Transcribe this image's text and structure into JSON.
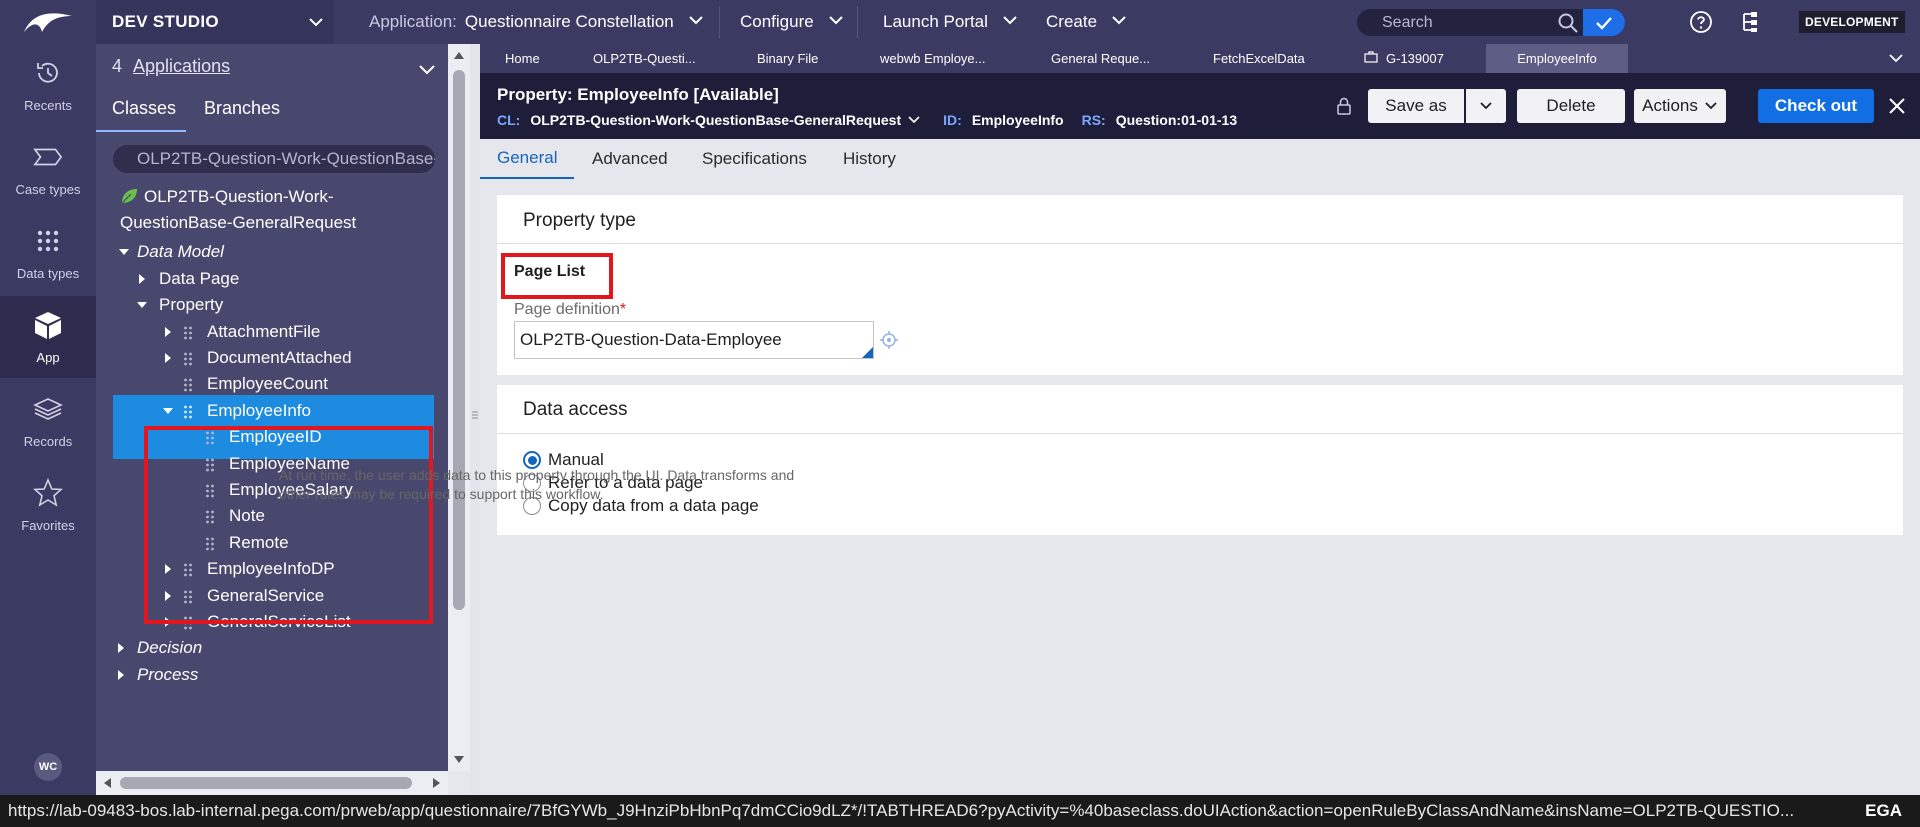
{
  "topbar": {
    "studio": "DEV STUDIO",
    "application_label": "Application:",
    "application_name": "Questionnaire Constellation",
    "configure": "Configure",
    "launch_portal": "Launch Portal",
    "create": "Create",
    "search_placeholder": "Search",
    "environment": "DEVELOPMENT"
  },
  "rail": {
    "items": [
      {
        "label": "Recents",
        "icon": "history-icon"
      },
      {
        "label": "Case types",
        "icon": "case-types-icon"
      },
      {
        "label": "Data types",
        "icon": "data-types-icon"
      },
      {
        "label": "App",
        "icon": "app-cube-icon"
      },
      {
        "label": "Records",
        "icon": "records-icon"
      },
      {
        "label": "Favorites",
        "icon": "star-icon"
      }
    ],
    "user_initials": "WC"
  },
  "explorer": {
    "apps_count": "4",
    "apps_label": "Applications",
    "tabs": [
      "Classes",
      "Branches"
    ],
    "class_filter": "OLP2TB-Question-Work-QuestionBase-GeneralRequest",
    "root_class_line1": "OLP2TB-Question-Work-",
    "root_class_line2": "QuestionBase-GeneralRequest",
    "tree": {
      "data_model": "Data Model",
      "data_page": "Data Page",
      "property": "Property",
      "attachment_file": "AttachmentFile",
      "document_attached": "DocumentAttached",
      "employee_count": "EmployeeCount",
      "employee_info": "EmployeeInfo",
      "employee_id": "EmployeeID",
      "employee_name": "EmployeeName",
      "employee_salary": "EmployeeSalary",
      "note": "Note",
      "remote": "Remote",
      "employee_info_dp": "EmployeeInfoDP",
      "general_service": "GeneralService",
      "general_service_list": "GeneralServiceList",
      "decision": "Decision",
      "process": "Process"
    }
  },
  "work_tabs": [
    "Home",
    "OLP2TB-Questi...",
    "Binary File",
    "webwb Employe...",
    "General Reque...",
    "FetchExcelData",
    "G-139007",
    "EmployeeInfo"
  ],
  "rule": {
    "title": "Property: EmployeeInfo [Available]",
    "cl_label": "CL:",
    "cl_value": "OLP2TB-Question-Work-QuestionBase-GeneralRequest",
    "id_label": "ID:",
    "id_value": "EmployeeInfo",
    "rs_label": "RS:",
    "rs_value": "Question:01-01-13",
    "buttons": {
      "save_as": "Save as",
      "delete": "Delete",
      "actions": "Actions",
      "check_out": "Check out"
    }
  },
  "rule_tabs": [
    "General",
    "Advanced",
    "Specifications",
    "History"
  ],
  "property_type": {
    "section_title": "Property type",
    "type": "Page List",
    "page_def_label": "Page definition",
    "required_mark": "*",
    "page_def_value": "OLP2TB-Question-Data-Employee"
  },
  "data_access": {
    "section_title": "Data access",
    "options": [
      "Manual",
      "Refer to a data page",
      "Copy data from a data page"
    ],
    "selected": "Manual",
    "help_line1": "At run time, the user adds data to this property through the UI. Data transforms and",
    "help_line2": "other rules may be required to support this workflow."
  },
  "statusbar": {
    "url": "https://lab-09483-bos.lab-internal.pega.com/prweb/app/questionnaire/7BfGYWb_J9HnziPbHbnPq7dmCCio9dLZ*/!TABTHREAD6?pyActivity=%40baseclass.doUIAction&action=openRuleByClassAndName&insName=OLP2TB-QUESTIO...",
    "brand": "EGA"
  },
  "colors": {
    "topbar": "#3b3a63",
    "header": "#1f1e3a",
    "accent": "#116ee3",
    "selected_row": "#1d8ce0",
    "highlight": "#e3161d"
  }
}
